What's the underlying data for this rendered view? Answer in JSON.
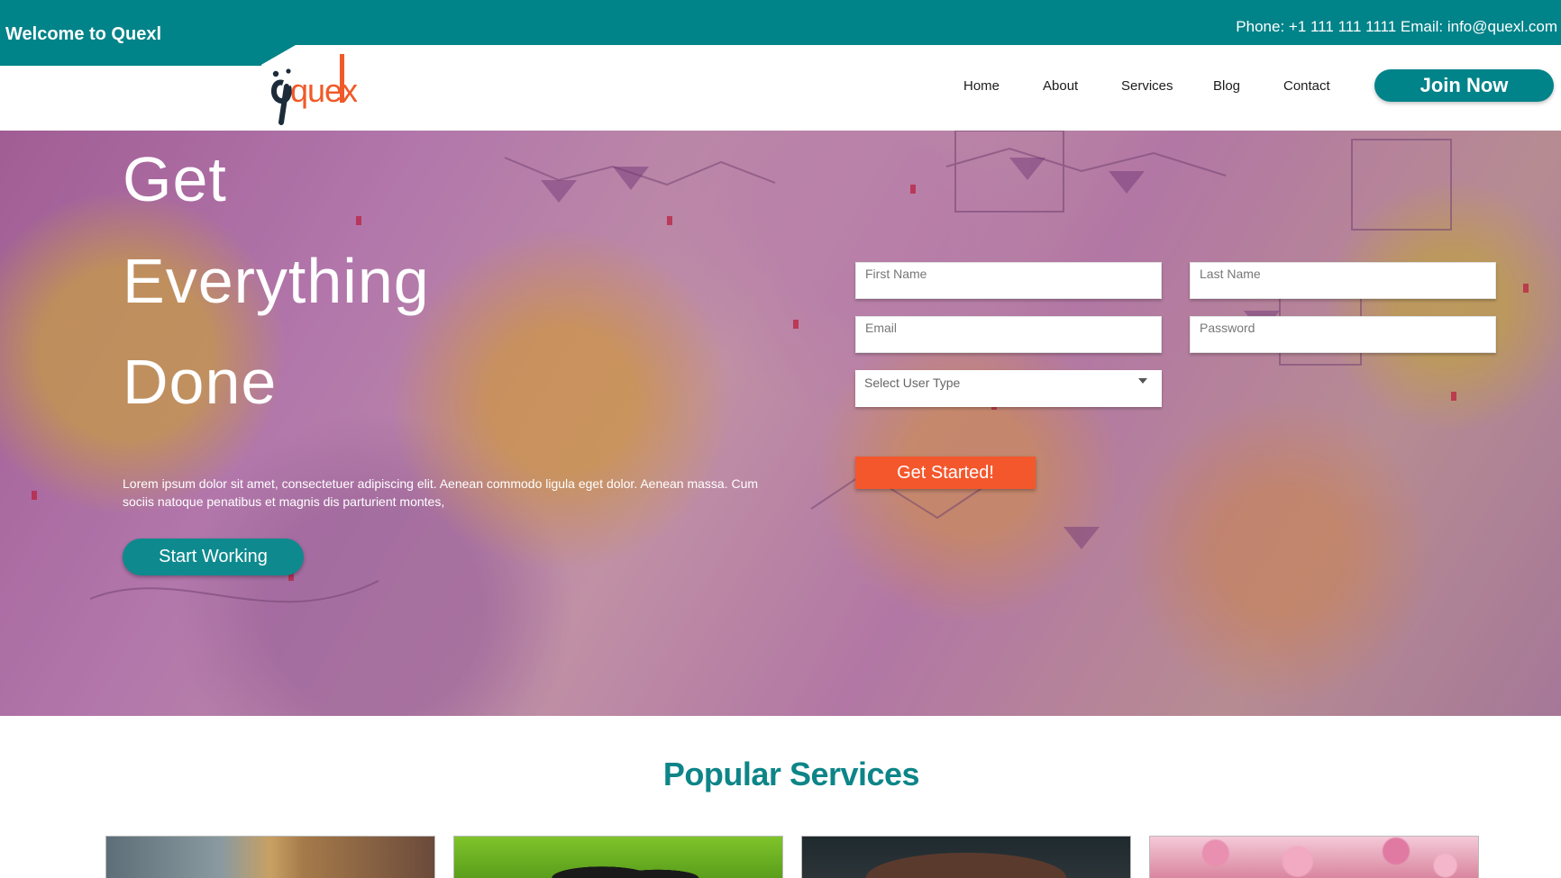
{
  "topbar": {
    "welcome": "Welcome to Quexl",
    "contact": "Phone: +1 111 111 1111 Email: info@quexl.com"
  },
  "header": {
    "logo_text": "quexl",
    "nav": [
      "Home",
      "About",
      "Services",
      "Blog",
      "Contact"
    ],
    "join_label": "Join Now"
  },
  "hero": {
    "headline": [
      "Get",
      "Everything",
      "Done"
    ],
    "text": "Lorem ipsum dolor sit amet, consectetuer adipiscing elit. Aenean commodo ligula eget dolor. Aenean massa. Cum sociis natoque penatibus et magnis dis parturient montes,",
    "start_label": "Start Working"
  },
  "form": {
    "first_name_placeholder": "First Name",
    "last_name_placeholder": "Last Name",
    "email_placeholder": "Email",
    "password_placeholder": "Password",
    "user_type_placeholder": "Select User Type",
    "submit_label": "Get Started!"
  },
  "services": {
    "title": "Popular Services"
  },
  "colors": {
    "brand_teal": "#008389",
    "accent_orange": "#f4572c"
  }
}
